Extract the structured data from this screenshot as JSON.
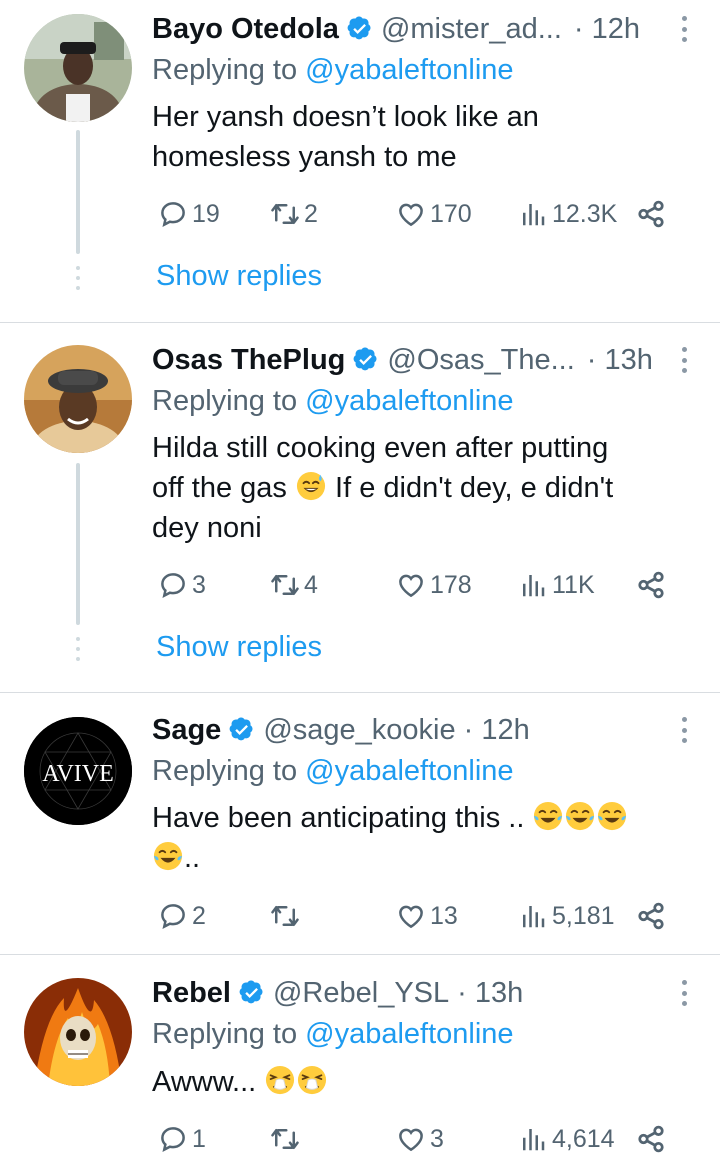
{
  "tweets": [
    {
      "author_name": "Bayo Otedola",
      "handle": "@mister_ad...",
      "time": "· 12h",
      "replying_prefix": "Replying to ",
      "replying_to": "@yabaleftonline",
      "text_lines": [
        "Her yansh doesn’t look like an",
        "homesless yansh to me"
      ],
      "comments": "19",
      "retweets": "2",
      "likes": "170",
      "views": "12.3K",
      "show_replies": "Show replies"
    },
    {
      "author_name": "Osas ThePlug",
      "handle": "@Osas_The...",
      "time": "· 13h",
      "replying_prefix": "Replying to ",
      "replying_to": "@yabaleftonline",
      "text_lines": [
        "Hilda still cooking even after putting",
        "off the gas",
        " If e didn't dey, e didn't",
        "dey noni"
      ],
      "comments": "3",
      "retweets": "4",
      "likes": "178",
      "views": "11K",
      "show_replies": "Show replies"
    },
    {
      "author_name": "Sage",
      "handle": "@sage_kookie",
      "time": "· 12h",
      "avatar_text": "AVIVE",
      "replying_prefix": "Replying to ",
      "replying_to": "@yabaleftonline",
      "text_lines": [
        "Have been anticipating this ..",
        ".."
      ],
      "comments": "2",
      "retweets": "",
      "likes": "13",
      "views": "5,181"
    },
    {
      "author_name": "Rebel",
      "handle": "@Rebel_YSL",
      "time": "· 13h",
      "replying_prefix": "Replying to ",
      "replying_to": "@yabaleftonline",
      "text_lines": [
        "Awww..."
      ],
      "comments": "1",
      "retweets": "",
      "likes": "3",
      "views": "4,614"
    }
  ],
  "colors": {
    "accent": "#1d9bf0",
    "secondary_text": "#536471",
    "primary_text": "#0f1419",
    "divider": "#d9dde1",
    "verified_badge": "#1d9bf0"
  },
  "icons": [
    "comment-icon",
    "retweet-icon",
    "like-icon",
    "views-icon",
    "share-icon",
    "verified-badge-icon",
    "more-options-icon"
  ]
}
